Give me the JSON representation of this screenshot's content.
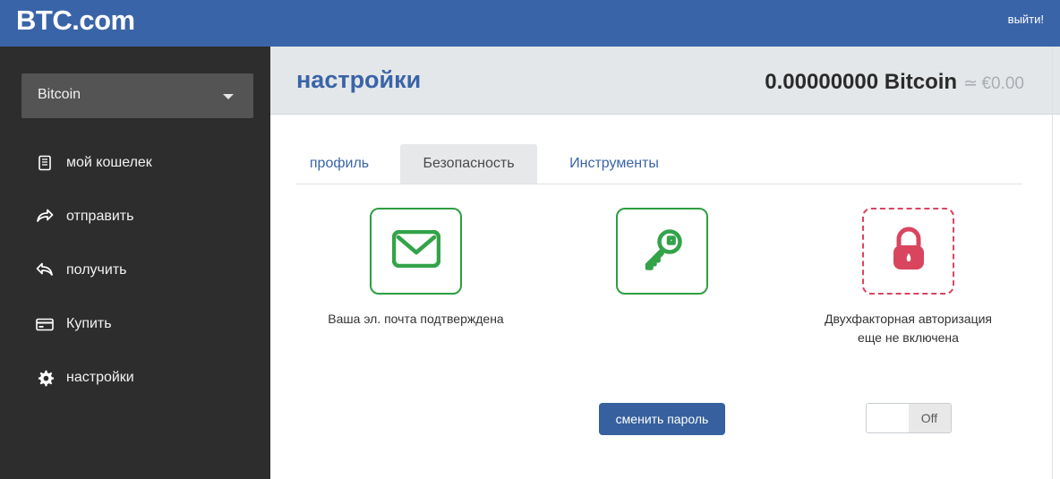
{
  "header": {
    "brand": "BTC.com",
    "logout_label": "выйти!"
  },
  "sidebar": {
    "coin_selector": {
      "value": "Bitcoin",
      "icon": "chevron-down-icon"
    },
    "items": [
      {
        "label": "мой кошелек",
        "icon": "wallet-document-icon"
      },
      {
        "label": "отправить",
        "icon": "send-arrow-icon"
      },
      {
        "label": "получить",
        "icon": "receive-arrow-icon"
      },
      {
        "label": "Купить",
        "icon": "credit-card-icon"
      },
      {
        "label": "настройки",
        "icon": "gear-icon"
      }
    ]
  },
  "main": {
    "page_title": "настройки",
    "balance": {
      "amount": "0.00000000 Bitcoin",
      "approx_symbol": "≃",
      "fiat": "€0.00"
    },
    "tabs": [
      {
        "label": "профиль",
        "active": false
      },
      {
        "label": "Безопасность",
        "active": true
      },
      {
        "label": "Инструменты",
        "active": false
      }
    ],
    "cards": [
      {
        "icon": "envelope-icon",
        "state": "ok",
        "caption_line1": "Ваша эл. почта подтверждена",
        "caption_line2": ""
      },
      {
        "icon": "key-icon",
        "state": "ok",
        "caption_line1": "",
        "caption_line2": "",
        "button_label": "сменить пароль"
      },
      {
        "icon": "lock-icon",
        "state": "warn",
        "caption_line1": "Двухфакторная авторизация",
        "caption_line2": "еще не включена",
        "toggle_state": "Off"
      }
    ]
  },
  "colors": {
    "header_blue": "#3a64a8",
    "sidebar_dark": "#2d2d2d",
    "title_blue": "#3a64a8",
    "ok_green": "#2f9e41",
    "warn_red": "#d9455f",
    "button_blue": "#36609e"
  }
}
